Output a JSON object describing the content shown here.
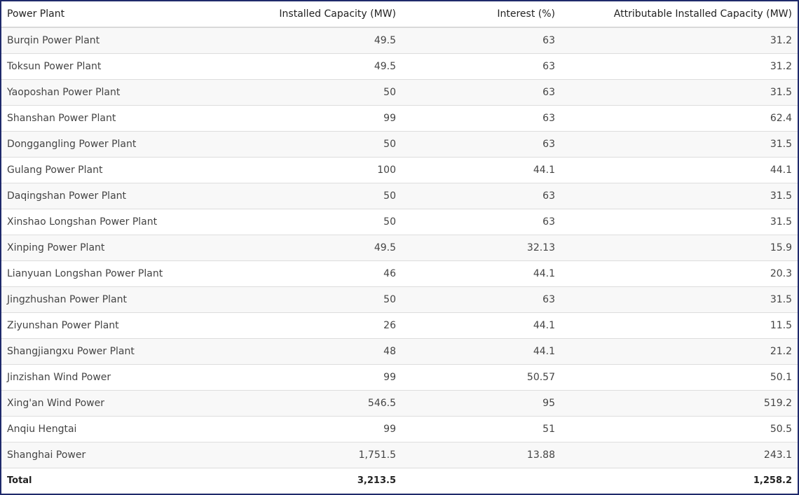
{
  "table": {
    "headers": [
      "Power Plant",
      "Installed Capacity (MW)",
      "Interest (%)",
      "Attributable Installed Capacity (MW)"
    ],
    "rows": [
      [
        "Burqin Power Plant",
        "49.5",
        "63",
        "31.2"
      ],
      [
        "Toksun Power Plant",
        "49.5",
        "63",
        "31.2"
      ],
      [
        "Yaoposhan Power Plant",
        "50",
        "63",
        "31.5"
      ],
      [
        "Shanshan Power Plant",
        "99",
        "63",
        "62.4"
      ],
      [
        "Donggangling Power Plant",
        "50",
        "63",
        "31.5"
      ],
      [
        "Gulang Power Plant",
        "100",
        "44.1",
        "44.1"
      ],
      [
        "Daqingshan Power Plant",
        "50",
        "63",
        "31.5"
      ],
      [
        "Xinshao Longshan Power Plant",
        "50",
        "63",
        "31.5"
      ],
      [
        "Xinping Power Plant",
        "49.5",
        "32.13",
        "15.9"
      ],
      [
        "Lianyuan Longshan Power Plant",
        "46",
        "44.1",
        "20.3"
      ],
      [
        "Jingzhushan Power Plant",
        "50",
        "63",
        "31.5"
      ],
      [
        "Ziyunshan Power Plant",
        "26",
        "44.1",
        "11.5"
      ],
      [
        "Shangjiangxu Power Plant",
        "48",
        "44.1",
        "21.2"
      ],
      [
        "Jinzishan Wind Power",
        "99",
        "50.57",
        "50.1"
      ],
      [
        "Xing'an Wind Power",
        "546.5",
        "95",
        "519.2"
      ],
      [
        "Anqiu Hengtai",
        "99",
        "51",
        "50.5"
      ],
      [
        "Shanghai Power",
        "1,751.5",
        "13.88",
        "243.1"
      ]
    ],
    "total": [
      "Total",
      "3,213.5",
      "",
      "1,258.2"
    ]
  }
}
